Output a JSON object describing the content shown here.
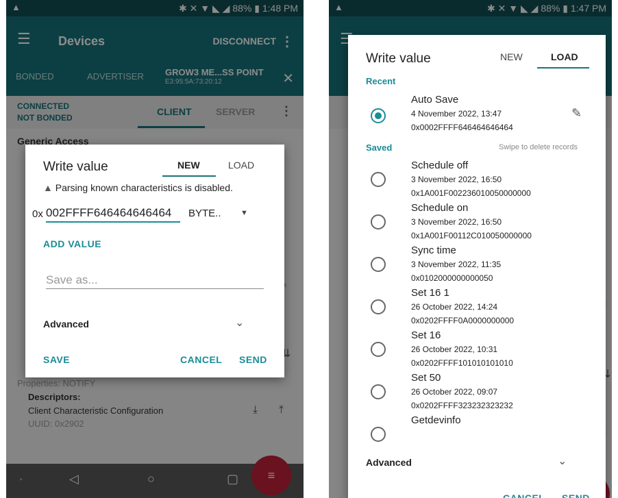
{
  "left_screen": {
    "status": {
      "warn": "▲",
      "icons": "✱ ✕ ▼ ◣ ◢",
      "battery": "88%",
      "time": "1:48 PM"
    },
    "appbar": {
      "title": "Devices",
      "action": "DISCONNECT"
    },
    "tabs": {
      "bonded": "BONDED",
      "advertiser": "ADVERTISER",
      "device_name": "GROW3 ME...SS POINT",
      "device_mac": "E3:95:5A:73:20:12"
    },
    "connection": {
      "state": "CONNECTED",
      "bond": "NOT BONDED",
      "client_tab": "CLIENT",
      "server_tab": "SERVER"
    },
    "background": {
      "service_title": "Generic Access",
      "properties": "Properties: NOTIFY",
      "descriptors_label": "Descriptors:",
      "descriptor_name": "Client Characteristic Configuration",
      "descriptor_uuid": "UUID: 0x2902"
    },
    "dialog": {
      "title": "Write value",
      "tab_new": "NEW",
      "tab_load": "LOAD",
      "warning": "Parsing known characteristics is disabled.",
      "hex_prefix": "0x",
      "hex_value": "002FFFF646464646464",
      "format": "BYTE..",
      "add_value": "ADD VALUE",
      "save_as_placeholder": "Save as...",
      "advanced": "Advanced",
      "save": "SAVE",
      "cancel": "CANCEL",
      "send": "SEND"
    }
  },
  "right_screen": {
    "status": {
      "warn": "▲",
      "icons": "✱ ✕ ▼ ◣ ◢",
      "battery": "88%",
      "time": "1:47 PM"
    },
    "dialog": {
      "title": "Write value",
      "tab_new": "NEW",
      "tab_load": "LOAD",
      "recent_label": "Recent",
      "recent": {
        "name": "Auto Save",
        "date": "4 November 2022, 13:47",
        "value": "0x0002FFFF646464646464"
      },
      "saved_label": "Saved",
      "swipe_hint": "Swipe to delete records",
      "records": [
        {
          "name": "Schedule off",
          "date": "3 November 2022, 16:50",
          "value": "0x1A001F002236010050000000"
        },
        {
          "name": "Schedule on",
          "date": "3 November 2022, 16:50",
          "value": "0x1A001F00112C010050000000"
        },
        {
          "name": "Sync time",
          "date": "3 November 2022, 11:35",
          "value": "0x0102000000000050"
        },
        {
          "name": "Set 16 1",
          "date": "26 October 2022, 14:24",
          "value": "0x0202FFFF0A0000000000"
        },
        {
          "name": "Set 16",
          "date": "26 October 2022, 10:31",
          "value": "0x0202FFFF101010101010"
        },
        {
          "name": "Set 50",
          "date": "26 October 2022, 09:07",
          "value": "0x0202FFFF323232323232"
        },
        {
          "name": "Getdevinfo",
          "date": "",
          "value": ""
        }
      ],
      "advanced": "Advanced",
      "cancel": "CANCEL",
      "send": "SEND"
    }
  }
}
